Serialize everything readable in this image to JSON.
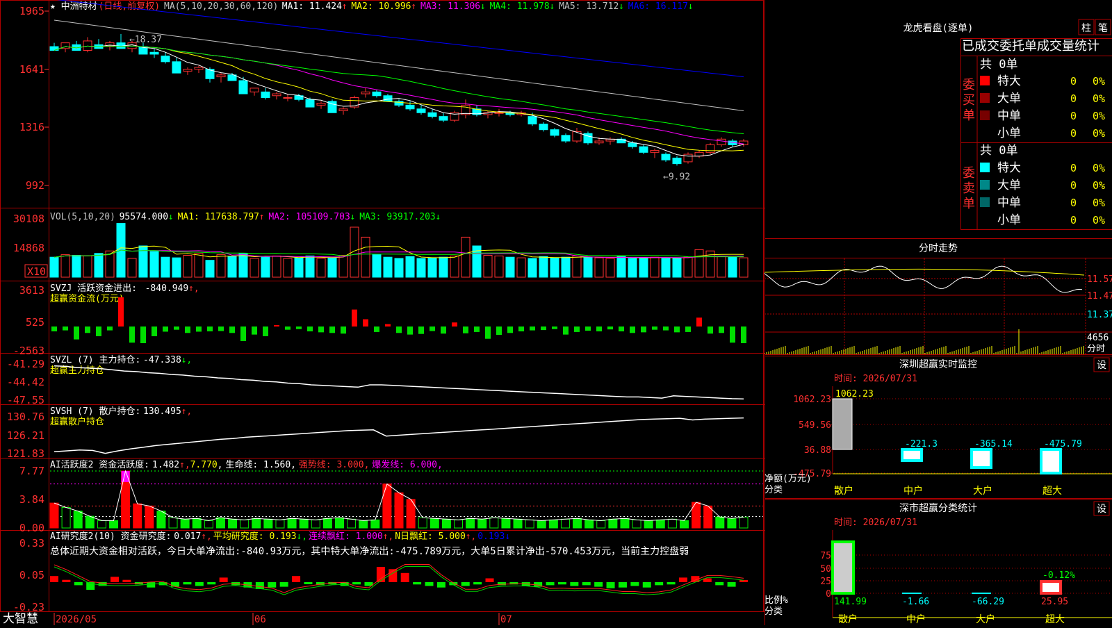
{
  "app": {
    "brand": "大智慧",
    "stock_name": "★ 中洲特材",
    "period_label": "(日线,前复权)"
  },
  "header_ma": {
    "param": "MA(5,10,20,30,60,120)",
    "items": [
      {
        "label": "MA1:",
        "value": "11.424",
        "dir": "up",
        "color": "#ffffff"
      },
      {
        "label": "MA2:",
        "value": "10.996",
        "dir": "up",
        "color": "#ffff00"
      },
      {
        "label": "MA3:",
        "value": "11.306",
        "dir": "down",
        "color": "#ff00ff"
      },
      {
        "label": "MA4:",
        "value": "11.978",
        "dir": "down",
        "color": "#00ff00"
      },
      {
        "label": "MA5:",
        "value": "13.712",
        "dir": "down",
        "color": "#c0c0c0"
      },
      {
        "label": "MA6:",
        "value": "16.117",
        "dir": "down",
        "color": "#0000ff"
      }
    ]
  },
  "price_axis": [
    "1965",
    "1641",
    "1316",
    "992"
  ],
  "price_annotations": {
    "high": "18.37",
    "low": "9.92"
  },
  "vol_header": {
    "param": "VOL(5,10,20)",
    "value": "95574.000",
    "items": [
      {
        "label": "MA1:",
        "value": "117638.797",
        "dir": "up",
        "color": "#ffff00"
      },
      {
        "label": "MA2:",
        "value": "105109.703",
        "dir": "down",
        "color": "#ff00ff"
      },
      {
        "label": "MA3:",
        "value": "93917.203",
        "dir": "down",
        "color": "#00ff00"
      }
    ],
    "axis": [
      "30108",
      "14868"
    ],
    "unit": "X10"
  },
  "svzj": {
    "title": "SVZJ  活跃资金进出:",
    "value": "-840.949",
    "subtitle": "超赢资金流(万元)",
    "axis": [
      "3613",
      "525",
      "-2563"
    ]
  },
  "svzl": {
    "title": "SVZL (7) 主力持仓:",
    "value": "-47.338",
    "subtitle": "超赢主力持仓",
    "axis": [
      "-41.29",
      "-44.42",
      "-47.55"
    ]
  },
  "svsh": {
    "title": "SVSH (7) 散户持仓:",
    "value": "130.495",
    "subtitle": "超赢散户持仓",
    "axis": [
      "130.76",
      "126.21",
      "121.83"
    ]
  },
  "ai_active": {
    "title": "AI活跃度2 资金活跃度:",
    "value": "1.482",
    "value2": "7.770",
    "life_label": "生命线:",
    "life_value": "1.560",
    "strong_label": "强势线:",
    "strong_value": "3.000",
    "burst_label": "爆发线:",
    "burst_value": "6.000",
    "axis": [
      "7.77",
      "3.84",
      "0.00"
    ]
  },
  "ai_research": {
    "title": "AI研究度2(10) 资金研究度:",
    "value": "0.017",
    "avg_label": "平均研究度:",
    "avg_value": "0.193",
    "red_label": "连续飘红:",
    "red_value": "1.000",
    "nred_label": "N日飘红:",
    "nred_value": "5.000",
    "last_value": "0.193",
    "summary": "总体近期大资金相对活跃，今日大单净流出:-840.93万元，其中特大单净流出:-475.789万元，大单5日累计净出-570.453万元，当前主力控盘弱",
    "axis": [
      "0.33",
      "0.05",
      "-0.23"
    ]
  },
  "date_axis": [
    "2026/05",
    "06",
    "07"
  ],
  "side": {
    "dragon_title": "龙虎看盘(逐单)",
    "btn_bar": "柱",
    "btn_deal": "笔",
    "tabs": [
      "已成交",
      "委托单",
      "成交量统计"
    ],
    "buy_label": "委买单",
    "sell_label": "委卖单",
    "buy_total": "共 0单",
    "sell_total": "共 0单",
    "buy_rows": [
      {
        "label": "特大",
        "count": "0",
        "pct": "0%",
        "color": "#ff0000"
      },
      {
        "label": "大单",
        "count": "0",
        "pct": "0%",
        "color": "#990000"
      },
      {
        "label": "中单",
        "count": "0",
        "pct": "0%",
        "color": "#770000"
      },
      {
        "label": "小单",
        "count": "0",
        "pct": "0%",
        "color": "#000000"
      }
    ],
    "sell_rows": [
      {
        "label": "特大",
        "count": "0",
        "pct": "0%",
        "color": "#00ffff"
      },
      {
        "label": "大单",
        "count": "0",
        "pct": "0%",
        "color": "#008888"
      },
      {
        "label": "中单",
        "count": "0",
        "pct": "0%",
        "color": "#006666"
      },
      {
        "label": "小单",
        "count": "0",
        "pct": "0%",
        "color": "#000000"
      }
    ],
    "intraday_title": "分时走势",
    "intraday_axis": [
      "11.57",
      "11.47",
      "11.37"
    ],
    "intraday_vol": "4656",
    "intraday_vol_label": "分时",
    "sz_monitor_title": "深圳超赢实时监控",
    "sz_set": "设",
    "sz_time": "时间: 2026/07/31",
    "sz_axis": [
      "1062.23",
      "549.56",
      "36.88",
      "-475.79"
    ],
    "sz_values": [
      "1062.23",
      "-221.3",
      "-365.14",
      "-475.79"
    ],
    "sz_ylabel": "净额(万元)",
    "sz_xlabel": "分类",
    "categories": [
      "散户",
      "中户",
      "大户",
      "超大"
    ],
    "stat_title": "深市超赢分类统计",
    "stat_set": "设",
    "stat_time": "时间: 2026/07/31",
    "stat_axis": [
      "75",
      "50",
      "25",
      "0"
    ],
    "stat_top_label": "-0.12%",
    "stat_values": [
      "141.99",
      "-1.66",
      "-66.29",
      "25.95"
    ],
    "stat_ylabel": "比例%",
    "stat_xlabel": "分类"
  },
  "chart_data": [
    {
      "type": "candlestick",
      "title": "中洲特材 日线 前复权",
      "ylim": [
        9.5,
        19.8
      ],
      "candles": [
        [
          17.7,
          17.9,
          17.5,
          17.5
        ],
        [
          17.6,
          17.8,
          17.4,
          17.9
        ],
        [
          17.8,
          18.0,
          17.6,
          17.5
        ],
        [
          17.5,
          18.2,
          17.4,
          18.0
        ],
        [
          17.8,
          18.1,
          17.6,
          17.6
        ],
        [
          17.7,
          18.0,
          17.5,
          17.9
        ],
        [
          17.9,
          18.37,
          17.6,
          17.6
        ],
        [
          17.6,
          18.0,
          17.4,
          17.9
        ],
        [
          17.7,
          17.9,
          17.3,
          17.3
        ],
        [
          17.4,
          17.6,
          17.1,
          17.3
        ],
        [
          17.2,
          17.4,
          16.8,
          16.9
        ],
        [
          16.9,
          17.1,
          16.3,
          16.3
        ],
        [
          16.4,
          16.6,
          16.2,
          16.5
        ],
        [
          16.5,
          16.7,
          16.3,
          16.6
        ],
        [
          16.5,
          16.6,
          15.8,
          16.0
        ],
        [
          16.1,
          16.3,
          15.8,
          16.2
        ],
        [
          16.2,
          16.3,
          15.9,
          15.9
        ],
        [
          15.9,
          16.1,
          15.2,
          15.2
        ],
        [
          15.3,
          15.5,
          15.1,
          15.5
        ],
        [
          15.3,
          15.5,
          14.9,
          15.0
        ],
        [
          15.1,
          15.3,
          14.9,
          15.2
        ],
        [
          15.0,
          15.2,
          14.8,
          15.0
        ],
        [
          15.1,
          15.2,
          14.8,
          14.9
        ],
        [
          14.9,
          15.0,
          14.5,
          14.5
        ],
        [
          14.6,
          14.8,
          14.4,
          14.7
        ],
        [
          14.8,
          14.9,
          14.2,
          14.2
        ],
        [
          14.3,
          14.5,
          14.1,
          14.4
        ],
        [
          14.5,
          15.1,
          14.4,
          15.0
        ],
        [
          15.2,
          15.5,
          15.0,
          15.3
        ],
        [
          15.3,
          15.4,
          15.0,
          15.1
        ],
        [
          15.1,
          15.2,
          14.8,
          14.8
        ],
        [
          14.8,
          14.9,
          14.5,
          14.6
        ],
        [
          14.6,
          14.8,
          14.3,
          14.4
        ],
        [
          14.4,
          14.6,
          14.1,
          14.2
        ],
        [
          14.2,
          14.4,
          13.9,
          14.0
        ],
        [
          14.0,
          14.2,
          13.7,
          13.8
        ],
        [
          13.8,
          14.3,
          13.7,
          14.2
        ],
        [
          14.1,
          14.9,
          13.9,
          14.6
        ],
        [
          14.4,
          14.6,
          14.0,
          14.1
        ],
        [
          14.1,
          14.3,
          13.9,
          14.2
        ],
        [
          14.2,
          14.4,
          14.0,
          14.2
        ],
        [
          14.2,
          14.3,
          14.0,
          14.1
        ],
        [
          14.1,
          14.3,
          14.0,
          14.2
        ],
        [
          14.0,
          14.2,
          13.5,
          13.6
        ],
        [
          13.6,
          13.7,
          13.2,
          13.3
        ],
        [
          13.3,
          13.4,
          12.9,
          13.0
        ],
        [
          13.0,
          13.1,
          12.6,
          12.7
        ],
        [
          12.7,
          13.4,
          12.6,
          13.2
        ],
        [
          13.1,
          13.2,
          12.5,
          12.6
        ],
        [
          12.6,
          12.9,
          12.5,
          12.7
        ],
        [
          12.7,
          12.9,
          12.5,
          12.8
        ],
        [
          12.8,
          12.9,
          12.6,
          12.6
        ],
        [
          12.6,
          12.7,
          12.3,
          12.4
        ],
        [
          12.4,
          12.5,
          12.0,
          12.1
        ],
        [
          12.1,
          12.3,
          11.8,
          12.2
        ],
        [
          12.0,
          12.1,
          11.6,
          11.7
        ],
        [
          11.8,
          11.9,
          11.4,
          11.5
        ],
        [
          11.6,
          12.1,
          11.5,
          12.0
        ],
        [
          11.9,
          12.2,
          11.8,
          12.1
        ],
        [
          12.1,
          12.6,
          12.0,
          12.5
        ],
        [
          12.5,
          12.9,
          12.4,
          12.8
        ],
        [
          12.7,
          12.8,
          12.4,
          12.5
        ],
        [
          12.5,
          12.8,
          12.4,
          12.7
        ]
      ]
    },
    {
      "type": "bar",
      "title": "VOL",
      "values": [
        3.2,
        3.6,
        3.5,
        3.4,
        3.8,
        4.2,
        8.6,
        3.0,
        5.0,
        4.1,
        3.2,
        3.1,
        3.5,
        3.8,
        2.7,
        3.6,
        3.3,
        3.8,
        3.0,
        3.2,
        3.4,
        3.0,
        3.1,
        3.4,
        3.0,
        3.1,
        3.5,
        8.0,
        6.4,
        3.6,
        3.2,
        3.0,
        3.3,
        3.0,
        3.1,
        3.2,
        3.4,
        6.4,
        5.0,
        3.5,
        3.4,
        3.2,
        3.1,
        3.0,
        3.3,
        3.1,
        3.2,
        3.4,
        3.2,
        3.1,
        3.0,
        3.3,
        3.0,
        3.1,
        3.2,
        3.0,
        3.1,
        3.2,
        4.4,
        4.2,
        3.3,
        3.2,
        3.1
      ]
    },
    {
      "type": "bar",
      "title": "SVZJ 活跃资金进出",
      "values": [
        -150,
        -120,
        -400,
        -200,
        -300,
        -120,
        3613,
        -500,
        -650,
        -300,
        -160,
        -100,
        -200,
        -160,
        -150,
        -140,
        -200,
        -450,
        -250,
        -300,
        60,
        -100,
        -80,
        -150,
        -180,
        -200,
        -220,
        2100,
        900,
        -170,
        300,
        -200,
        -250,
        -230,
        -140,
        -220,
        500,
        -210,
        -170,
        -380,
        -260,
        -200,
        -150,
        -120,
        -110,
        -80,
        -250,
        -170,
        -130,
        -150,
        -90,
        -150,
        -200,
        -180,
        -100,
        -120,
        -180,
        -170,
        1100,
        -220,
        -200,
        -500,
        -840.949
      ]
    },
    {
      "type": "line",
      "title": "SVZL 主力持仓",
      "ylim": [
        -47.55,
        -41.29
      ],
      "values": [
        -41.6,
        -41.7,
        -41.9,
        -42.0,
        -42.1,
        -42.3,
        -42.5,
        -42.6,
        -42.8,
        -42.9,
        -43.1,
        -43.2,
        -43.4,
        -43.5,
        -43.7,
        -43.8,
        -44.0,
        -44.1,
        -44.3,
        -44.4,
        -44.6,
        -44.7,
        -44.9,
        -45.0,
        -45.1,
        -45.2,
        -45.3,
        -44.9,
        -44.9,
        -45.0,
        -45.1,
        -45.2,
        -45.3,
        -45.4,
        -45.5,
        -45.6,
        -45.7,
        -45.8,
        -45.9,
        -46.0,
        -46.1,
        -46.2,
        -46.3,
        -46.4,
        -46.5,
        -46.6,
        -46.7,
        -46.8,
        -46.9,
        -47.0,
        -47.0,
        -47.1,
        -47.2,
        -46.8,
        -46.9,
        -47.0,
        -47.1,
        -47.2,
        -47.3,
        -47.338
      ]
    },
    {
      "type": "line",
      "title": "SVSH 散户持仓",
      "ylim": [
        121.83,
        130.76
      ],
      "values": [
        122.3,
        122.5,
        122.7,
        122.6,
        121.9,
        122.5,
        123.0,
        123.4,
        123.8,
        124.1,
        124.4,
        124.7,
        125.0,
        125.3,
        125.5,
        125.8,
        126.0,
        126.2,
        126.4,
        126.6,
        126.8,
        127.0,
        127.2,
        127.4,
        127.5,
        127.6,
        126.1,
        126.3,
        126.5,
        126.7,
        126.9,
        127.1,
        127.3,
        127.5,
        127.7,
        127.9,
        128.1,
        128.3,
        128.5,
        128.7,
        128.9,
        129.1,
        129.3,
        129.5,
        129.7,
        129.9,
        130.1,
        130.2,
        130.3,
        130.4,
        130.0,
        130.2,
        130.3,
        130.4,
        130.495
      ]
    },
    {
      "type": "bar",
      "title": "AI活跃度2",
      "values": [
        3.4,
        2.8,
        2.3,
        1.6,
        1.0,
        1.0,
        8.6,
        3.3,
        3.0,
        2.3,
        1.4,
        1.2,
        1.3,
        1.0,
        1.4,
        1.2,
        1.1,
        1.3,
        1.2,
        1.1,
        1.3,
        1.2,
        1.1,
        1.3,
        1.4,
        1.2,
        1.0,
        1.1,
        6.0,
        4.8,
        3.9,
        1.4,
        1.3,
        1.2,
        1.1,
        1.3,
        1.2,
        1.4,
        1.3,
        1.2,
        1.1,
        1.0,
        1.1,
        1.2,
        1.3,
        1.1,
        1.0,
        1.2,
        1.3,
        1.1,
        1.0,
        1.1,
        1.2,
        1.0,
        3.5,
        3.0,
        1.5,
        1.3,
        1.482
      ]
    },
    {
      "type": "bar",
      "title": "AI研究度2",
      "values": [
        0.08,
        0.03,
        -0.04,
        -0.1,
        -0.05,
        0.07,
        0.03,
        -0.03,
        -0.07,
        -0.04,
        -0.06,
        -0.03,
        -0.05,
        -0.03,
        0.06,
        -0.04,
        -0.07,
        -0.09,
        -0.07,
        -0.06,
        0.08,
        -0.02,
        -0.04,
        -0.03,
        -0.05,
        -0.03,
        -0.05,
        0.2,
        0.17,
        0.12,
        -0.03,
        -0.05,
        -0.07,
        -0.04,
        -0.05,
        -0.03,
        0.05,
        -0.04,
        -0.03,
        -0.05,
        -0.06,
        -0.04,
        -0.03,
        -0.05,
        -0.04,
        -0.06,
        -0.08,
        -0.07,
        -0.05,
        -0.07,
        -0.04,
        -0.03,
        0.06,
        0.08,
        0.05,
        -0.04,
        -0.06,
        0.017
      ]
    }
  ]
}
